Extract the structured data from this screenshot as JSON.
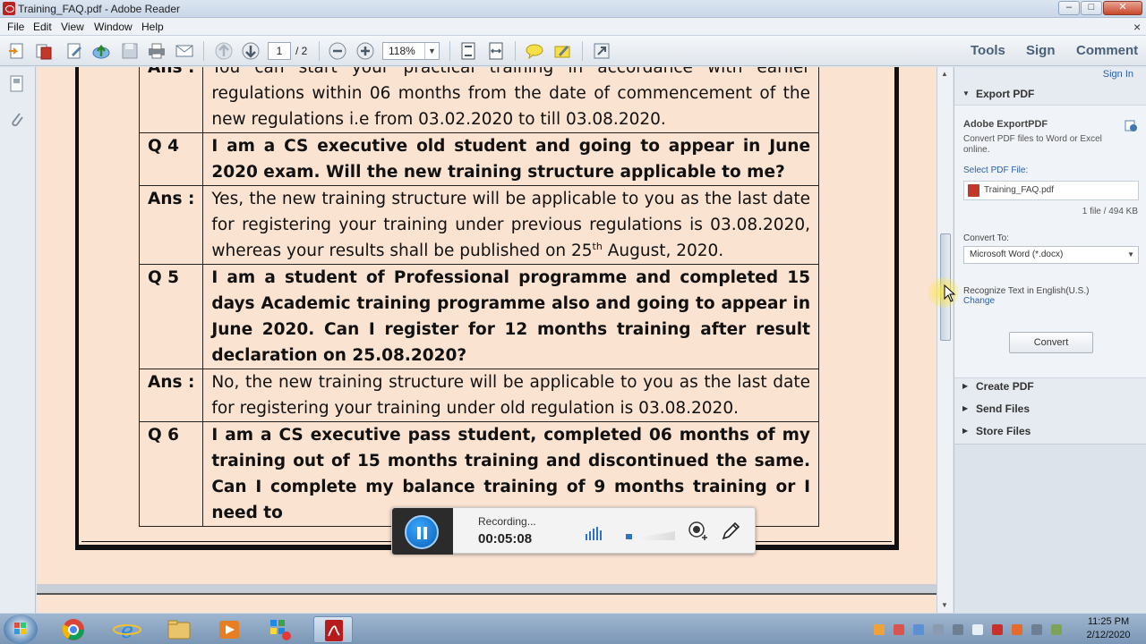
{
  "window": {
    "title": "Training_FAQ.pdf - Adobe Reader"
  },
  "menu": [
    "File",
    "Edit",
    "View",
    "Window",
    "Help"
  ],
  "toolbar": {
    "page_current": "1",
    "page_total": "/ 2",
    "zoom": "118%",
    "tools_label": "Tools",
    "sign_label": "Sign",
    "comment_label": "Comment"
  },
  "document": {
    "rows": [
      {
        "label": "Ans :",
        "text": "You can start your practical training in accordance with earlier regulations within 06 months from the date of commencement of the new regulations i.e from 03.02.2020 to till 03.08.2020.",
        "type": "ans"
      },
      {
        "label": "Q 4",
        "text": "I am a CS executive old student and going to appear in June 2020 exam. Will the new training structure applicable to me?",
        "type": "q"
      },
      {
        "label": "Ans :",
        "text_before_sup": "Yes, the new training structure will be applicable to you as the last date for registering your training under previous regulations is 03.08.2020, whereas your results shall be published on 25",
        "sup": "th",
        "text_after_sup": " August, 2020.",
        "type": "ans"
      },
      {
        "label": "Q 5",
        "text": "I am a student of Professional programme and completed 15 days Academic training programme also and going to appear in June 2020. Can I register for 12 months training after result declaration on 25.08.2020?",
        "type": "q"
      },
      {
        "label": "Ans :",
        "text": "No, the new training structure will be applicable to you as the last date for registering your training under old regulation is 03.08.2020.",
        "type": "ans"
      },
      {
        "label": "Q 6",
        "text": "I am a CS executive pass student, completed 06 months of my training out of 15 months training and discontinued the same. Can I complete my balance training of 9 months training or I need to",
        "type": "q"
      }
    ]
  },
  "right_panel": {
    "sign_in": "Sign In",
    "export_pdf": "Export PDF",
    "adobe_exportpdf": "Adobe ExportPDF",
    "description": "Convert PDF files to Word or Excel online.",
    "select_label": "Select PDF File:",
    "file_name": "Training_FAQ.pdf",
    "file_count": "1 file / 494 KB",
    "convert_to_label": "Convert To:",
    "convert_to_value": "Microsoft Word (*.docx)",
    "recognize_text": "Recognize Text in English(U.S.)",
    "change_link": "Change",
    "convert_button": "Convert",
    "create_pdf": "Create PDF",
    "send_files": "Send Files",
    "store_files": "Store Files"
  },
  "recorder": {
    "status": "Recording...",
    "time": "00:05:08"
  },
  "taskbar": {
    "time": "11:25 PM",
    "date": "2/12/2020"
  },
  "colors": {
    "page_background": "#fbe3d2",
    "link_blue": "#2b5fa8",
    "accent": "#0b5fb8"
  }
}
